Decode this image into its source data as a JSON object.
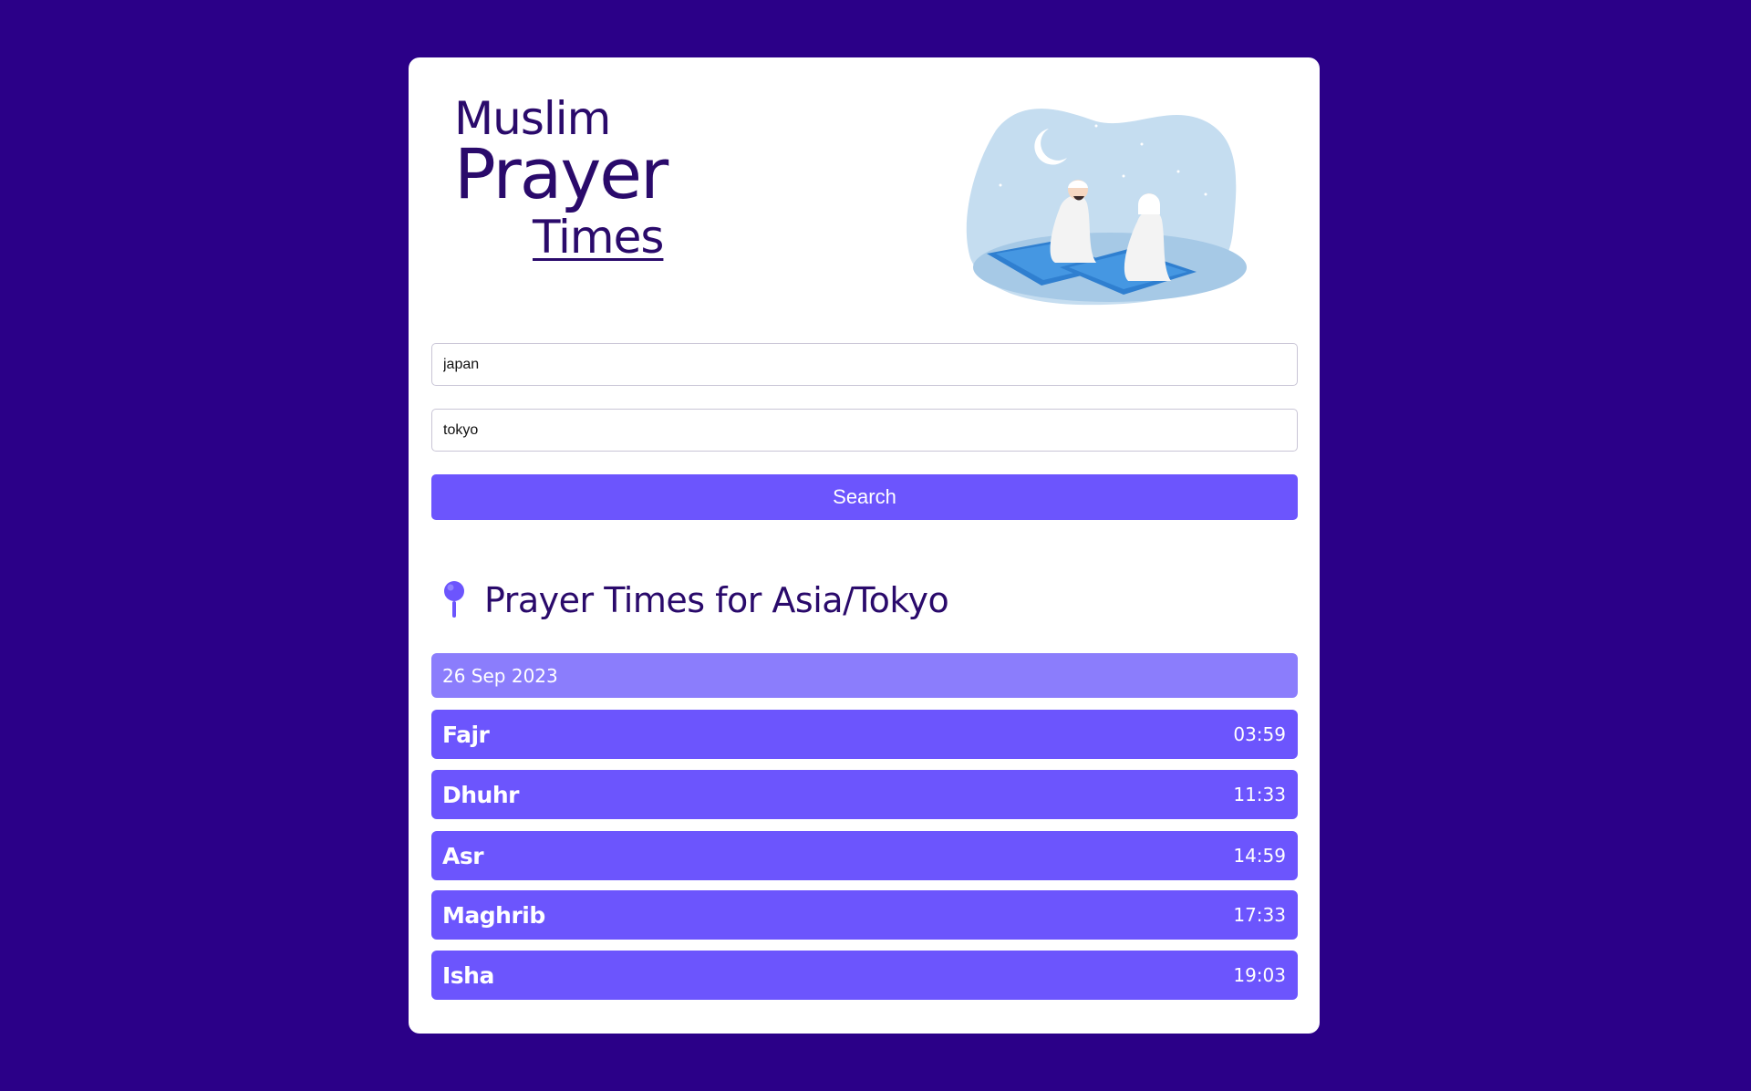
{
  "title": {
    "line1": "Muslim",
    "line2": "Prayer",
    "line3": "Times"
  },
  "form": {
    "country_value": "japan",
    "city_value": "tokyo",
    "search_label": "Search"
  },
  "location": {
    "icon": "map-pin-icon",
    "heading": "Prayer Times for Asia/Tokyo"
  },
  "date": "26 Sep 2023",
  "prayers": [
    {
      "name": "Fajr",
      "time": "03:59"
    },
    {
      "name": "Dhuhr",
      "time": "11:33"
    },
    {
      "name": "Asr",
      "time": "14:59"
    },
    {
      "name": "Maghrib",
      "time": "17:33"
    },
    {
      "name": "Isha",
      "time": "19:03"
    }
  ],
  "colors": {
    "background": "#2b0088",
    "accent": "#6c55fd",
    "date_bar": "#8b7dfc",
    "heading_text": "#2a0a6b"
  }
}
